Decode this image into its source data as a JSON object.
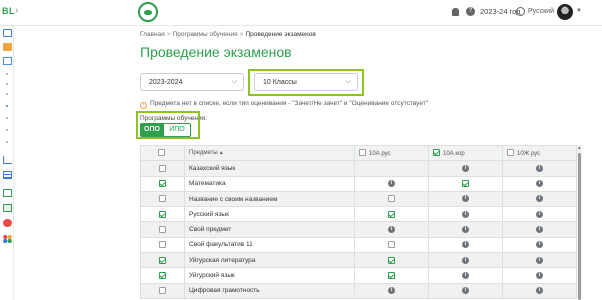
{
  "topbar": {
    "brand": "BL",
    "collapse_glyph": "›",
    "academic_year": "2023-24 год",
    "language": "Русский",
    "help_glyph": "?"
  },
  "sidebar": {
    "icons": [
      "monitor-icon",
      "folder-icon",
      "computer-icon",
      "chart-icon",
      "table-icon",
      "card-icon",
      "id-card-icon",
      "help-icon",
      "apps-icon"
    ]
  },
  "breadcrumb": {
    "items": [
      "Главная",
      "Программы обучения",
      "Проведение экзаменов"
    ],
    "separator": ">"
  },
  "page": {
    "title": "Проведение экзаменов"
  },
  "filters": {
    "year": "2023-2024",
    "classes": "10 Классы"
  },
  "note": {
    "icon": "!",
    "text": "Предмета нет в списке, если тип оценивания - \"Зачет/Не зачет\" и \"Оценивание отсутствует\""
  },
  "program": {
    "label": "Программы обучения:",
    "options": [
      "ОПО",
      "ИПО"
    ],
    "selected": "ОПО"
  },
  "table": {
    "columns": {
      "subjects": "Предметы",
      "sort_glyph": "▲",
      "classes": [
        "10А рус",
        "10А кор",
        "10Ж рус"
      ],
      "classes_checked": [
        false,
        true,
        false
      ]
    },
    "rows": [
      {
        "name": "Казахский язык",
        "selected": false,
        "cells": [
          "none",
          "info",
          "info"
        ]
      },
      {
        "name": "Математика",
        "selected": true,
        "cells": [
          "info",
          "checked",
          "info"
        ]
      },
      {
        "name": "Название с своим названием",
        "selected": false,
        "cells": [
          "unchecked",
          "info",
          "info"
        ]
      },
      {
        "name": "Русский язык",
        "selected": true,
        "cells": [
          "checked",
          "info",
          "info"
        ]
      },
      {
        "name": "Свой предмет",
        "selected": false,
        "cells": [
          "info",
          "info",
          "info"
        ]
      },
      {
        "name": "Свой факультатив 11",
        "selected": false,
        "cells": [
          "unchecked",
          "info",
          "info"
        ]
      },
      {
        "name": "Уйгурская литература",
        "selected": true,
        "cells": [
          "checked",
          "info",
          "info"
        ]
      },
      {
        "name": "Уйгурский язык",
        "selected": true,
        "cells": [
          "checked",
          "info",
          "info"
        ]
      },
      {
        "name": "Цифровая грамотность",
        "selected": false,
        "cells": [
          "info",
          "info",
          "info"
        ]
      }
    ]
  }
}
